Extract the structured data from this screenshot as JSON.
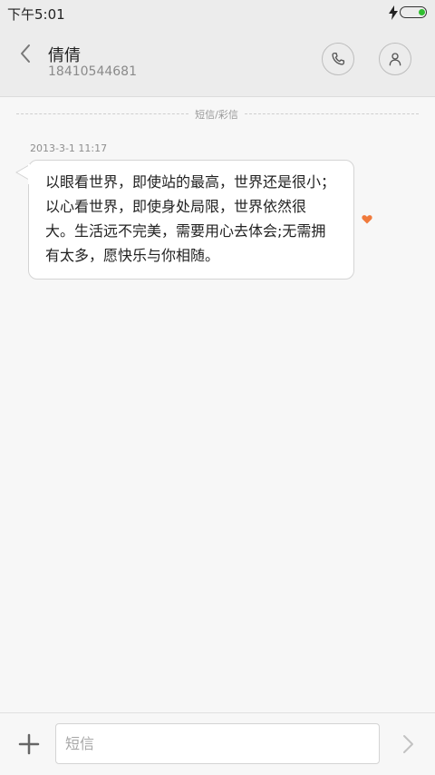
{
  "status_bar": {
    "time": "下午5:01",
    "icons": [
      "charging-bolt-icon",
      "battery-icon"
    ],
    "battery_color": "#2fbf2f"
  },
  "header": {
    "contact_name": "倩倩",
    "contact_number": "18410544681",
    "icons": [
      "back-chevron-icon",
      "phone-icon",
      "person-icon"
    ]
  },
  "conversation": {
    "divider_label": "短信/彩信",
    "messages": [
      {
        "timestamp": "2013-3-1 11:17",
        "text": "以眼看世界，即使站的最高，世界还是很小；\n以心看世界，即使身处局限，世界依然很\n大。生活远不完美，需要用心去体会;无需拥\n有太多，愿快乐与你相随。",
        "icon": "heart-icon",
        "accent_color": "#f07a3c"
      }
    ]
  },
  "composer": {
    "placeholder": "短信",
    "value": "",
    "icons": [
      "plus-icon",
      "send-chevron-icon"
    ]
  }
}
